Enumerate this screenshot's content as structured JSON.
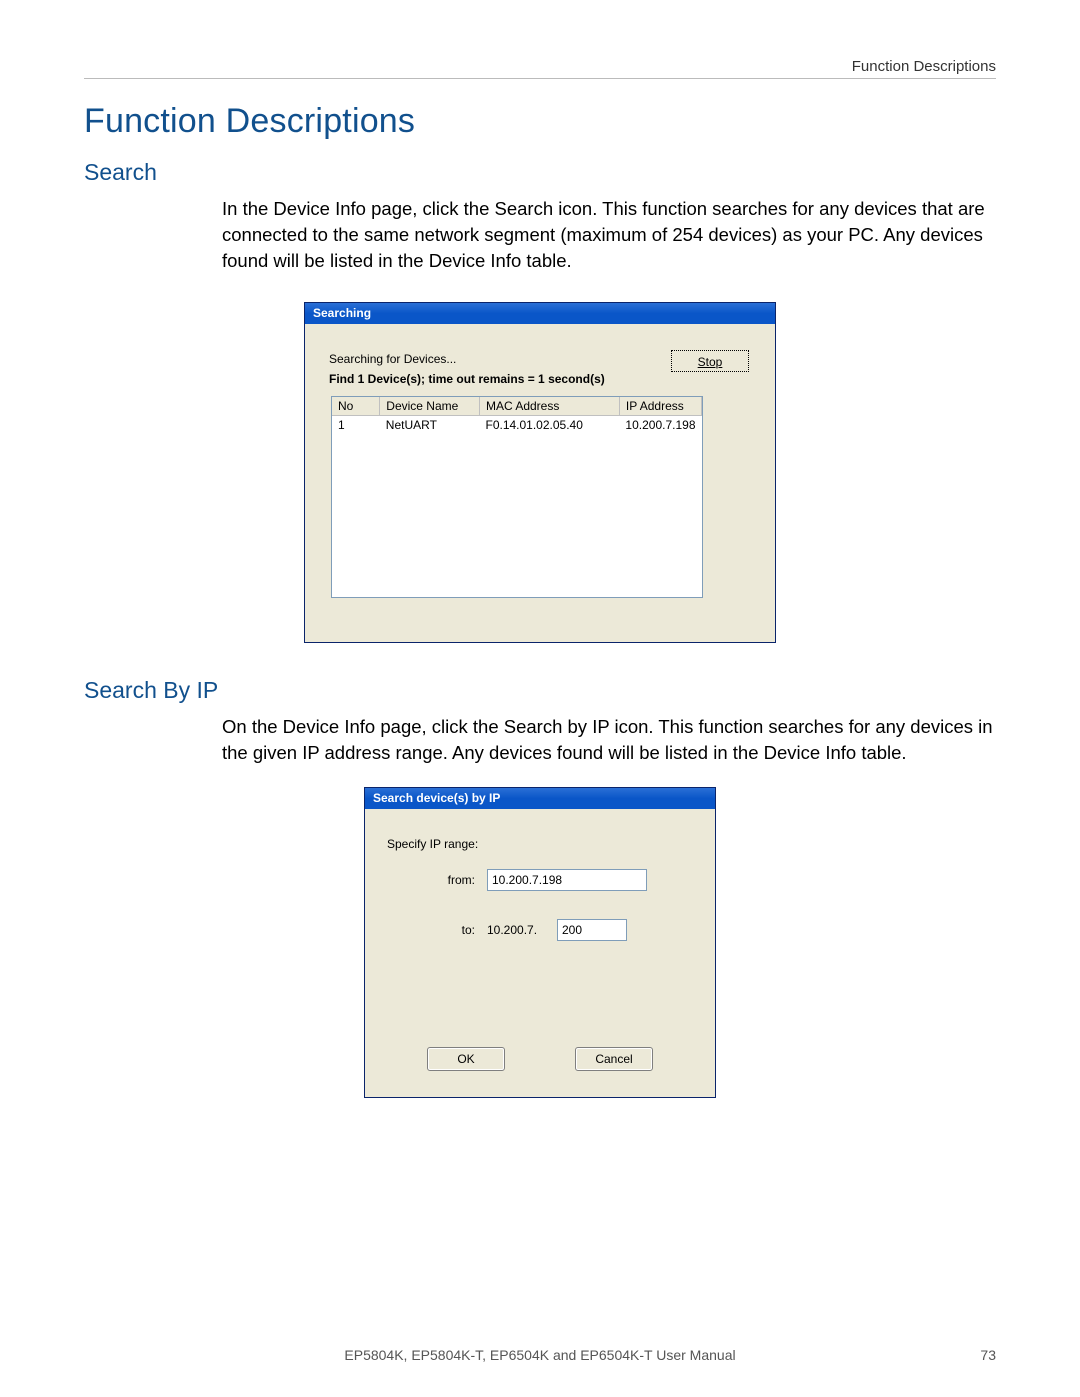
{
  "header_right": "Function Descriptions",
  "title": "Function Descriptions",
  "section1": {
    "heading": "Search",
    "body": "In the Device Info page, click the Search icon. This function searches for any devices that are connected to the same network segment (maximum of 254 devices) as your PC. Any devices found will be listed in the Device Info table."
  },
  "dialog1": {
    "title": "Searching",
    "stop_label": "Stop",
    "line1": "Searching for  Devices...",
    "line2": "Find 1 Device(s); time out remains = 1 second(s)",
    "columns": [
      "No",
      "Device Name",
      "MAC Address",
      "IP Address"
    ],
    "rows": [
      {
        "no": "1",
        "name": "NetUART",
        "mac": "F0.14.01.02.05.40",
        "ip": "10.200.7.198"
      }
    ]
  },
  "section2": {
    "heading": "Search By IP",
    "body": "On the Device Info page, click the Search by IP icon. This function searches for any devices in the given IP address range. Any devices found will be listed in the Device Info table."
  },
  "dialog2": {
    "title": "Search device(s) by IP",
    "specify_label": "Specify IP range:",
    "from_label": "from:",
    "from_value": "10.200.7.198",
    "to_label": "to:",
    "to_prefix": "10.200.7.",
    "to_value": "200",
    "ok_label": "OK",
    "cancel_label": "Cancel"
  },
  "footer": {
    "center": "EP5804K, EP5804K-T, EP6504K and EP6504K-T User Manual",
    "page": "73"
  }
}
